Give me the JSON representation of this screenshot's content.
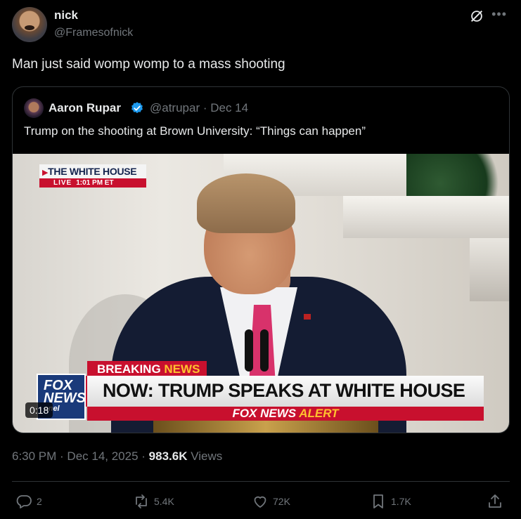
{
  "author": {
    "name": "nick",
    "handle": "@Framesofnick"
  },
  "tweet": {
    "text": "Man just said womp womp to a mass shooting",
    "timestamp": "6:30 PM · Dec 14, 2025 · ",
    "views_count": "983.6K",
    "views_label": " Views"
  },
  "quoted": {
    "name": "Aaron Rupar",
    "handle": "@atrupar · Dec 14",
    "text": "Trump on the shooting at Brown University: “Things can happen”",
    "video": {
      "duration": "0:18",
      "bug_title": "THE WHITE HOUSE",
      "bug_live": "LIVE",
      "bug_time": "1:01 PM ET",
      "breaking": "BREAKING",
      "breaking_news": "NEWS",
      "headline": "NOW: TRUMP SPEAKS AT WHITE HOUSE",
      "alert_brand": "FOX NEWS",
      "alert_word": "ALERT",
      "logo_line1": "FOX",
      "logo_line2": "NEWS",
      "logo_line3": "nnel"
    }
  },
  "actions": {
    "replies": "2",
    "reposts": "5.4K",
    "likes": "72K",
    "bookmarks": "1.7K"
  },
  "colors": {
    "background": "#000000",
    "text": "#e7e9ea",
    "secondary": "#71767b",
    "border": "#2f3336",
    "verified": "#1d9bf0",
    "fox_red": "#c8102e"
  }
}
